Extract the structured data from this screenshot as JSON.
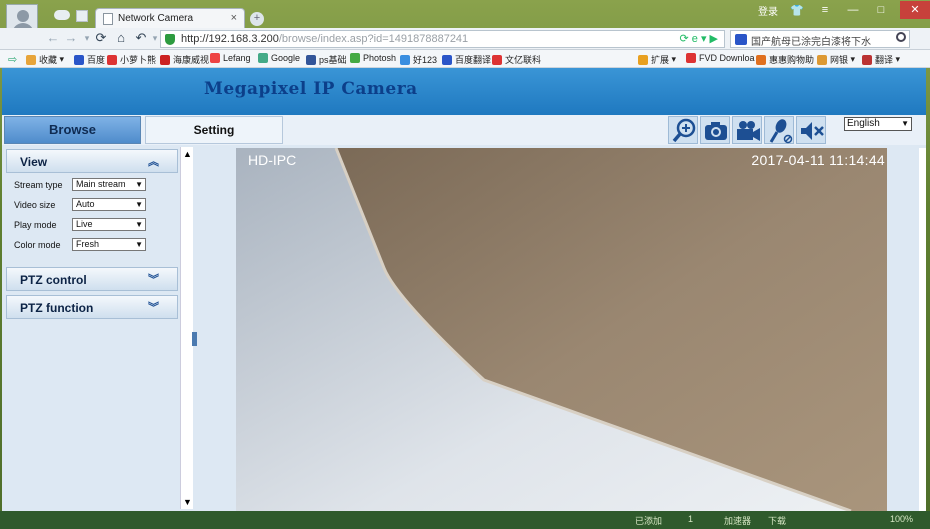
{
  "browser": {
    "tab_title": "Network Camera",
    "tab_close": "×",
    "new_tab": "+",
    "window_controls": [
      "登录",
      "👕",
      "≡",
      "—",
      "□",
      "✕"
    ],
    "url_host": "http://192.168.3.200",
    "url_path": "/browse/index.asp?id=1491878887241",
    "url_right": "⟳ e ▾ ▶",
    "search_text": "国产航母已涂完白漆将下水",
    "bookmarks": [
      "收藏",
      "百度",
      "小萝卜熊",
      "海康威视",
      "Lefang",
      "Google",
      "ps基础",
      "Photosh",
      "好123",
      "百度翻译",
      "文亿联科",
      "扩展",
      "FVD Downloa",
      "惠惠购物助",
      "网银",
      "翻译"
    ],
    "bookmark_colors": [
      "#e7a43a",
      "#2a55c8",
      "#d33",
      "#c22",
      "#e44",
      "#4a8",
      "#359",
      "#4a4",
      "#3a8ee0",
      "#2a55c8",
      "#d33",
      "#e8a020",
      "#d33",
      "#e07020",
      "#d93",
      "#b33"
    ]
  },
  "app": {
    "banner_title": "Megapixel IP Camera",
    "nav": {
      "browse": "Browse",
      "setting": "Setting"
    },
    "toolbar_icons": [
      "zoom-in-icon",
      "snapshot-icon",
      "record-icon",
      "microphone-icon",
      "mute-icon"
    ],
    "language": {
      "selected": "English"
    },
    "sidebar": {
      "view": {
        "title": "View",
        "chevron": "︽",
        "rows": [
          {
            "label": "Stream type",
            "value": "Main stream"
          },
          {
            "label": "Video size",
            "value": "Auto"
          },
          {
            "label": "Play mode",
            "value": "Live"
          },
          {
            "label": "Color mode",
            "value": "Fresh"
          }
        ]
      },
      "ptz_control": {
        "title": "PTZ control",
        "chevron": "︾"
      },
      "ptz_function": {
        "title": "PTZ function",
        "chevron": "︾"
      }
    },
    "video": {
      "overlay_name": "HD-IPC",
      "overlay_datetime": "2017-04-11  11:14:44"
    }
  },
  "taskbar": {
    "items": [
      "已添加",
      "1",
      "加速器",
      "下载",
      "100%"
    ]
  }
}
